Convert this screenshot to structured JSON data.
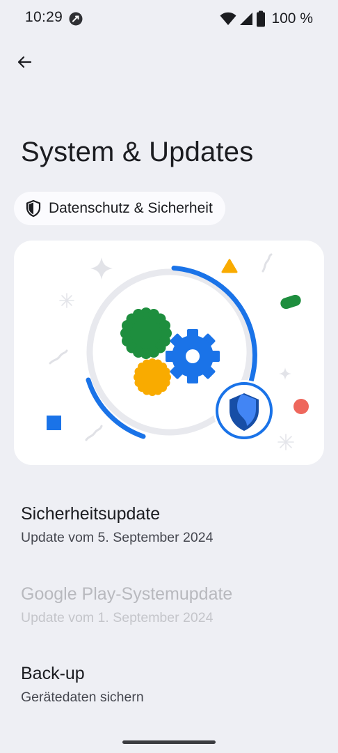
{
  "status_bar": {
    "time": "10:29",
    "battery": "100 %",
    "icons": [
      "app-notification-icon",
      "wifi-icon",
      "cellular-signal-icon",
      "battery-full-icon"
    ]
  },
  "header": {
    "back_icon": "arrow-back-icon",
    "title": "System & Updates"
  },
  "chip": {
    "icon": "shield-outline-icon",
    "label": "Datenschutz & Sicherheit"
  },
  "illustration": {
    "description_icons": [
      "gear-icon",
      "shield-icon"
    ],
    "colors": {
      "blue": "#1a73e8",
      "green": "#1e8e3e",
      "yellow": "#f9ab00",
      "red": "#ee675c",
      "ring": "#e8e9ee"
    }
  },
  "items": [
    {
      "title": "Sicherheitsupdate",
      "subtitle": "Update vom 5. September 2024",
      "enabled": true
    },
    {
      "title": "Google Play-Systemupdate",
      "subtitle": "Update vom 1. September 2024",
      "enabled": false
    },
    {
      "title": "Back-up",
      "subtitle": "Gerätedaten sichern",
      "enabled": true
    }
  ],
  "colors": {
    "background": "#eeeff4",
    "card": "#ffffff",
    "chip": "#fbfbfe",
    "text": "#1b1c20",
    "disabled_text": "#b8b9be"
  }
}
